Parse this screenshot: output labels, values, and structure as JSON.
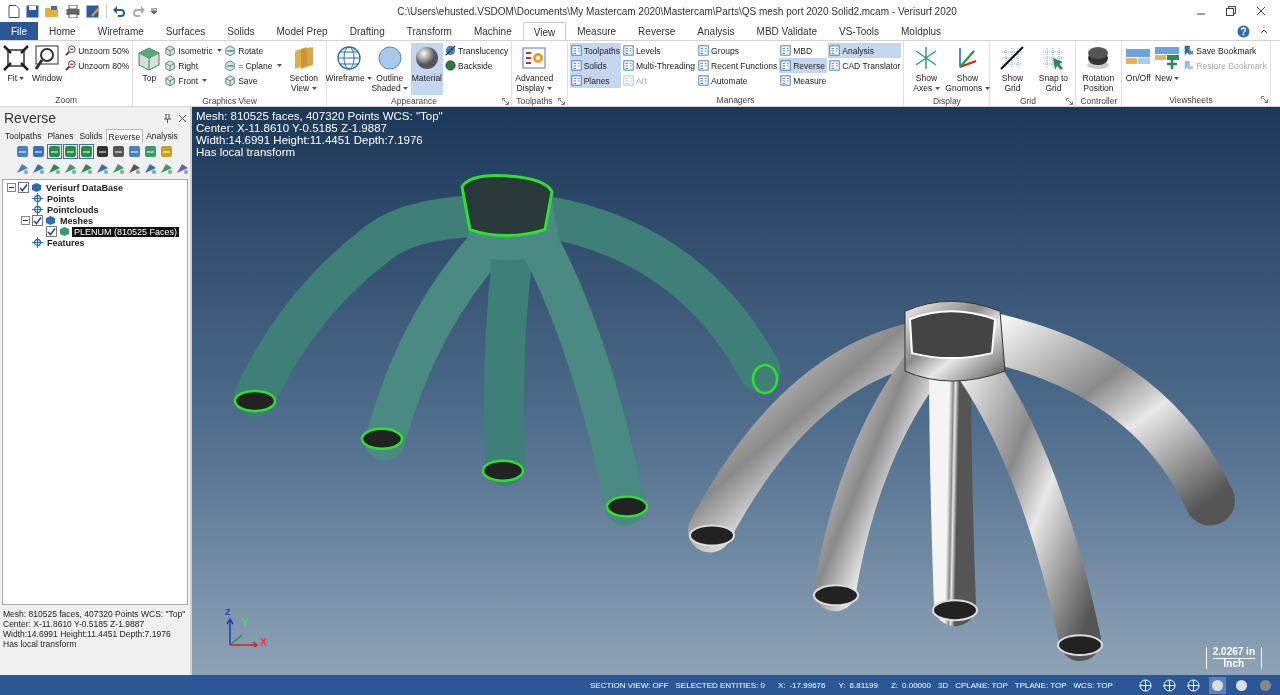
{
  "window": {
    "title": "C:\\Users\\ehusted.VSDOM\\Documents\\My Mastercam 2020\\Mastercam\\Parts\\QS mesh port 2020 Solid2.mcam - Verisurf 2020"
  },
  "tabs": [
    {
      "label": "File",
      "kind": "file",
      "selected": false
    },
    {
      "label": "Home",
      "kind": "tab",
      "selected": false
    },
    {
      "label": "Wireframe",
      "kind": "tab",
      "selected": false
    },
    {
      "label": "Surfaces",
      "kind": "tab",
      "selected": false
    },
    {
      "label": "Solids",
      "kind": "tab",
      "selected": false
    },
    {
      "label": "Model Prep",
      "kind": "tab",
      "selected": false
    },
    {
      "label": "Drafting",
      "kind": "tab",
      "selected": false
    },
    {
      "label": "Transform",
      "kind": "tab",
      "selected": false
    },
    {
      "label": "Machine",
      "kind": "tab",
      "selected": false
    },
    {
      "label": "View",
      "kind": "tab",
      "selected": true
    },
    {
      "label": "Measure",
      "kind": "tab",
      "selected": false
    },
    {
      "label": "Reverse",
      "kind": "tab",
      "selected": false
    },
    {
      "label": "Analysis",
      "kind": "tab",
      "selected": false
    },
    {
      "label": "MBD Validate",
      "kind": "tab",
      "selected": false
    },
    {
      "label": "VS-Tools",
      "kind": "tab",
      "selected": false
    },
    {
      "label": "Moldplus",
      "kind": "tab",
      "selected": false
    }
  ],
  "ribbon": {
    "groups": [
      {
        "label": "Zoom",
        "launcher": false,
        "items": [
          {
            "kind": "large",
            "label": "Fit",
            "dropdown": true,
            "selected": false,
            "disabled": false
          },
          {
            "kind": "large",
            "label": "Window",
            "dropdown": false,
            "selected": false,
            "disabled": false
          },
          {
            "kind": "small",
            "label": "Unzoom 50%",
            "dropdown": false,
            "selected": false,
            "disabled": false
          },
          {
            "kind": "small",
            "label": "Unzoom 80%",
            "dropdown": false,
            "selected": false,
            "disabled": false
          }
        ]
      },
      {
        "label": "Graphics View",
        "launcher": false,
        "items": [
          {
            "kind": "large",
            "label": "Top",
            "dropdown": false,
            "selected": false,
            "disabled": false
          },
          {
            "kind": "small",
            "label": "Isometric",
            "dropdown": true,
            "selected": false,
            "disabled": false
          },
          {
            "kind": "small",
            "label": "Right",
            "dropdown": false,
            "selected": false,
            "disabled": false
          },
          {
            "kind": "small",
            "label": "Front",
            "dropdown": true,
            "selected": false,
            "disabled": false
          },
          {
            "kind": "small",
            "label": "Rotate",
            "dropdown": false,
            "selected": false,
            "disabled": false
          },
          {
            "kind": "small",
            "label": "= Cplane",
            "dropdown": true,
            "selected": false,
            "disabled": false
          },
          {
            "kind": "small",
            "label": "Save",
            "dropdown": false,
            "selected": false,
            "disabled": false
          },
          {
            "kind": "large",
            "label": "Section View",
            "dropdown": true,
            "selected": false,
            "disabled": false
          }
        ]
      },
      {
        "label": "Appearance",
        "launcher": true,
        "items": [
          {
            "kind": "large",
            "label": "Wireframe",
            "dropdown": true,
            "selected": false,
            "disabled": false
          },
          {
            "kind": "large",
            "label": "Outline Shaded",
            "dropdown": true,
            "selected": false,
            "disabled": false
          },
          {
            "kind": "large",
            "label": "Material",
            "dropdown": false,
            "selected": true,
            "disabled": false
          },
          {
            "kind": "small",
            "label": "Translucency",
            "dropdown": false,
            "selected": false,
            "disabled": false
          },
          {
            "kind": "small",
            "label": "Backside",
            "dropdown": false,
            "selected": false,
            "disabled": false
          }
        ]
      },
      {
        "label": "Toolpaths",
        "launcher": true,
        "items": [
          {
            "kind": "large",
            "label": "Advanced Display",
            "dropdown": true,
            "selected": false,
            "disabled": false
          }
        ]
      },
      {
        "label": "Managers",
        "launcher": false,
        "items": [
          {
            "kind": "small",
            "label": "Toolpaths",
            "dropdown": false,
            "selected": true,
            "disabled": false
          },
          {
            "kind": "small",
            "label": "Solids",
            "dropdown": false,
            "selected": true,
            "disabled": false
          },
          {
            "kind": "small",
            "label": "Planes",
            "dropdown": false,
            "selected": true,
            "disabled": false
          },
          {
            "kind": "small",
            "label": "Levels",
            "dropdown": false,
            "selected": false,
            "disabled": false
          },
          {
            "kind": "small",
            "label": "Multi-Threading",
            "dropdown": false,
            "selected": false,
            "disabled": false
          },
          {
            "kind": "small",
            "label": "Art",
            "dropdown": false,
            "selected": false,
            "disabled": true
          },
          {
            "kind": "small",
            "label": "Groups",
            "dropdown": false,
            "selected": false,
            "disabled": false
          },
          {
            "kind": "small",
            "label": "Recent Functions",
            "dropdown": false,
            "selected": false,
            "disabled": false
          },
          {
            "kind": "small",
            "label": "Automate",
            "dropdown": false,
            "selected": false,
            "disabled": false
          },
          {
            "kind": "small",
            "label": "MBD",
            "dropdown": false,
            "selected": false,
            "disabled": false
          },
          {
            "kind": "small",
            "label": "Reverse",
            "dropdown": false,
            "selected": true,
            "disabled": false
          },
          {
            "kind": "small",
            "label": "Measure",
            "dropdown": false,
            "selected": false,
            "disabled": false
          },
          {
            "kind": "small",
            "label": "Analysis",
            "dropdown": false,
            "selected": true,
            "disabled": false
          },
          {
            "kind": "small",
            "label": "CAD Translator",
            "dropdown": false,
            "selected": false,
            "disabled": false
          }
        ]
      },
      {
        "label": "Display",
        "launcher": false,
        "items": [
          {
            "kind": "large",
            "label": "Show Axes",
            "dropdown": true,
            "selected": false,
            "disabled": false
          },
          {
            "kind": "large",
            "label": "Show Gnomons",
            "dropdown": true,
            "selected": false,
            "disabled": false
          }
        ]
      },
      {
        "label": "Grid",
        "launcher": true,
        "items": [
          {
            "kind": "large",
            "label": "Show Grid",
            "dropdown": false,
            "selected": false,
            "disabled": false
          },
          {
            "kind": "large",
            "label": "Snap to Grid",
            "dropdown": false,
            "selected": false,
            "disabled": false
          }
        ]
      },
      {
        "label": "Controller",
        "launcher": false,
        "items": [
          {
            "kind": "large",
            "label": "Rotation Position",
            "dropdown": false,
            "selected": false,
            "disabled": false
          }
        ]
      },
      {
        "label": "Viewsheets",
        "launcher": true,
        "items": [
          {
            "kind": "large",
            "label": "On/Off",
            "dropdown": false,
            "selected": false,
            "disabled": false
          },
          {
            "kind": "large",
            "label": "New",
            "dropdown": true,
            "selected": false,
            "disabled": false
          },
          {
            "kind": "small",
            "label": "Save Bookmark",
            "dropdown": false,
            "selected": false,
            "disabled": false
          },
          {
            "kind": "small",
            "label": "Restore Bookmark",
            "dropdown": false,
            "selected": false,
            "disabled": true
          }
        ]
      }
    ]
  },
  "panel": {
    "title": "Reverse",
    "tabs": [
      {
        "label": "Toolpaths",
        "selected": false
      },
      {
        "label": "Planes",
        "selected": false
      },
      {
        "label": "Solids",
        "selected": false
      },
      {
        "label": "Reverse",
        "selected": true
      },
      {
        "label": "Analysis",
        "selected": false
      }
    ],
    "tree": [
      {
        "label": "Verisurf DataBase",
        "kind": "check",
        "checked": true,
        "expanded": true,
        "selected": false,
        "children": [
          {
            "label": "Points",
            "kind": "plain",
            "selected": false
          },
          {
            "label": "Pointclouds",
            "kind": "plain",
            "selected": false
          },
          {
            "label": "Meshes",
            "kind": "check",
            "checked": true,
            "expanded": true,
            "selected": false,
            "children": [
              {
                "label": "PLENUM (810525 Faces)",
                "kind": "check",
                "checked": true,
                "selected": true
              }
            ]
          },
          {
            "label": "Features",
            "kind": "plain",
            "selected": false
          }
        ]
      }
    ],
    "info": [
      "Mesh: 810525 faces, 407320 Points  WCS: \"Top\"",
      "Center: X-11.8610 Y-0.5185 Z-1.9887",
      "Width:14.6991 Height:11.4451 Depth:7.1976",
      "Has local transform"
    ]
  },
  "viewport": {
    "info": [
      "Mesh: 810525 faces, 407320 Points  WCS: \"Top\"",
      "Center: X-11.8610 Y-0.5185 Z-1.9887",
      "Width:14.6991 Height:11.4451 Depth:7.1976",
      "Has local transform"
    ],
    "gnomon": {
      "x": "X",
      "y": "Y",
      "z": "Z"
    },
    "scale": {
      "value": "2.0267 in",
      "unit": "Inch"
    }
  },
  "status_bar": {
    "items": [
      {
        "label": "SECTION VIEW: OFF"
      },
      {
        "label": "SELECTED ENTITIES: 0"
      }
    ],
    "coords": [
      {
        "axis": "X:",
        "value": "-17.99676"
      },
      {
        "axis": "Y:",
        "value": "6.81199"
      },
      {
        "axis": "Z:",
        "value": "0.00000"
      }
    ],
    "planes": [
      {
        "label": "3D"
      },
      {
        "label": "CPLANE: TOP"
      },
      {
        "label": "TPLANE: TOP"
      },
      {
        "label": "WCS: TOP"
      }
    ],
    "shading": [
      {
        "selected": false
      },
      {
        "selected": false
      },
      {
        "selected": false
      },
      {
        "selected": true
      },
      {
        "selected": false
      },
      {
        "selected": false
      }
    ]
  }
}
